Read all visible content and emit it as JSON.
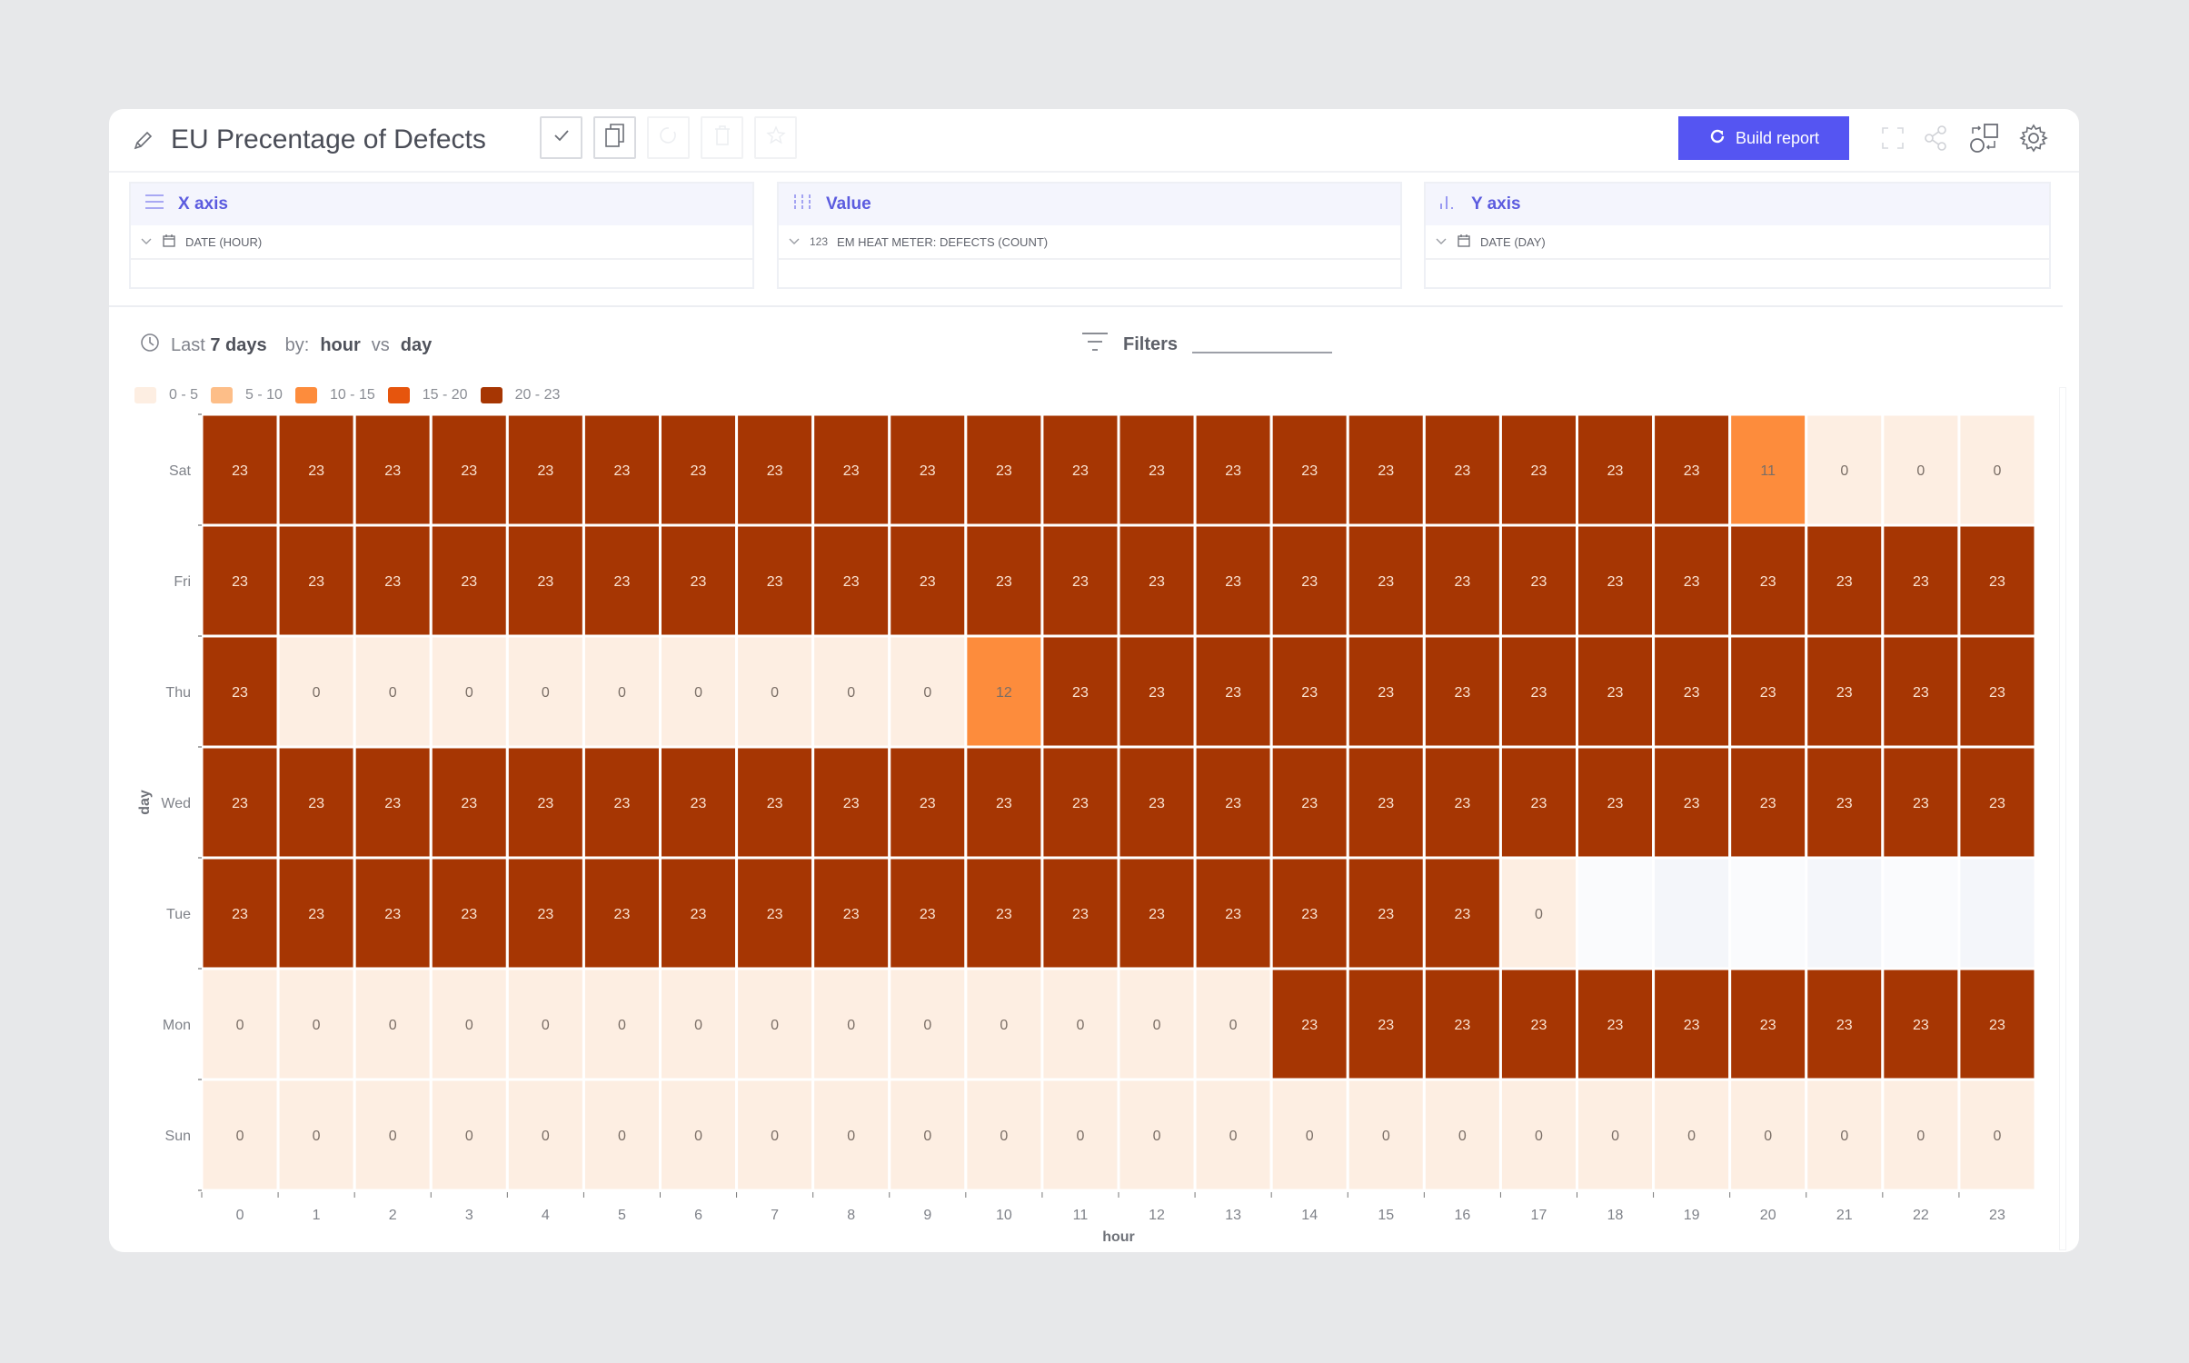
{
  "header": {
    "title": "EU Precentage of Defects",
    "build_button": "Build report",
    "tools": [
      "check-icon",
      "copy-icon",
      "refresh-icon",
      "trash-icon",
      "star-icon"
    ],
    "right_icons": [
      "fullscreen-icon",
      "share-icon",
      "swap-icon",
      "gear-icon"
    ],
    "accent": "#5555f2"
  },
  "panels": [
    {
      "title": "X axis",
      "field": "DATE (HOUR)",
      "field_icon": "calendar-icon"
    },
    {
      "title": "Value",
      "field": "EM HEAT METER: DEFECTS (COUNT)",
      "field_icon": "123"
    },
    {
      "title": "Y axis",
      "field": "DATE (DAY)",
      "field_icon": "calendar-icon"
    }
  ],
  "info": {
    "prefix": "Last",
    "period": "7 days",
    "by_label": "by:",
    "x_dim": "hour",
    "vs": "vs",
    "y_dim": "day"
  },
  "filters": {
    "label": "Filters",
    "value": ""
  },
  "chart_data": {
    "type": "heatmap",
    "title": "EU Precentage of Defects",
    "xlabel": "hour",
    "ylabel": "day",
    "x": [
      "0",
      "1",
      "2",
      "3",
      "4",
      "5",
      "6",
      "7",
      "8",
      "9",
      "10",
      "11",
      "12",
      "13",
      "14",
      "15",
      "16",
      "17",
      "18",
      "19",
      "20",
      "21",
      "22",
      "23"
    ],
    "y": [
      "Sat",
      "Fri",
      "Thu",
      "Wed",
      "Tue",
      "Mon",
      "Sun"
    ],
    "values": [
      [
        23,
        23,
        23,
        23,
        23,
        23,
        23,
        23,
        23,
        23,
        23,
        23,
        23,
        23,
        23,
        23,
        23,
        23,
        23,
        23,
        11,
        0,
        0,
        0
      ],
      [
        23,
        23,
        23,
        23,
        23,
        23,
        23,
        23,
        23,
        23,
        23,
        23,
        23,
        23,
        23,
        23,
        23,
        23,
        23,
        23,
        23,
        23,
        23,
        23
      ],
      [
        23,
        0,
        0,
        0,
        0,
        0,
        0,
        0,
        0,
        0,
        12,
        23,
        23,
        23,
        23,
        23,
        23,
        23,
        23,
        23,
        23,
        23,
        23,
        23
      ],
      [
        23,
        23,
        23,
        23,
        23,
        23,
        23,
        23,
        23,
        23,
        23,
        23,
        23,
        23,
        23,
        23,
        23,
        23,
        23,
        23,
        23,
        23,
        23,
        23
      ],
      [
        23,
        23,
        23,
        23,
        23,
        23,
        23,
        23,
        23,
        23,
        23,
        23,
        23,
        23,
        23,
        23,
        23,
        0,
        null,
        null,
        null,
        null,
        null,
        null
      ],
      [
        0,
        0,
        0,
        0,
        0,
        0,
        0,
        0,
        0,
        0,
        0,
        0,
        0,
        0,
        23,
        23,
        23,
        23,
        23,
        23,
        23,
        23,
        23,
        23
      ],
      [
        0,
        0,
        0,
        0,
        0,
        0,
        0,
        0,
        0,
        0,
        0,
        0,
        0,
        0,
        0,
        0,
        0,
        0,
        0,
        0,
        0,
        0,
        0,
        0
      ]
    ],
    "legend": [
      {
        "label": "0 - 5",
        "min": 0,
        "max": 5,
        "color": "#fdeee2"
      },
      {
        "label": "5 - 10",
        "min": 5,
        "max": 10,
        "color": "#fdbe88"
      },
      {
        "label": "10 - 15",
        "min": 10,
        "max": 15,
        "color": "#fd8c3c"
      },
      {
        "label": "15 - 20",
        "min": 15,
        "max": 20,
        "color": "#e6550d"
      },
      {
        "label": "20 - 23",
        "min": 20,
        "max": 23,
        "color": "#a63603"
      }
    ],
    "legend_position": "top-left",
    "empty_colors": [
      "#fafbfd",
      "#f4f6fa"
    ]
  }
}
